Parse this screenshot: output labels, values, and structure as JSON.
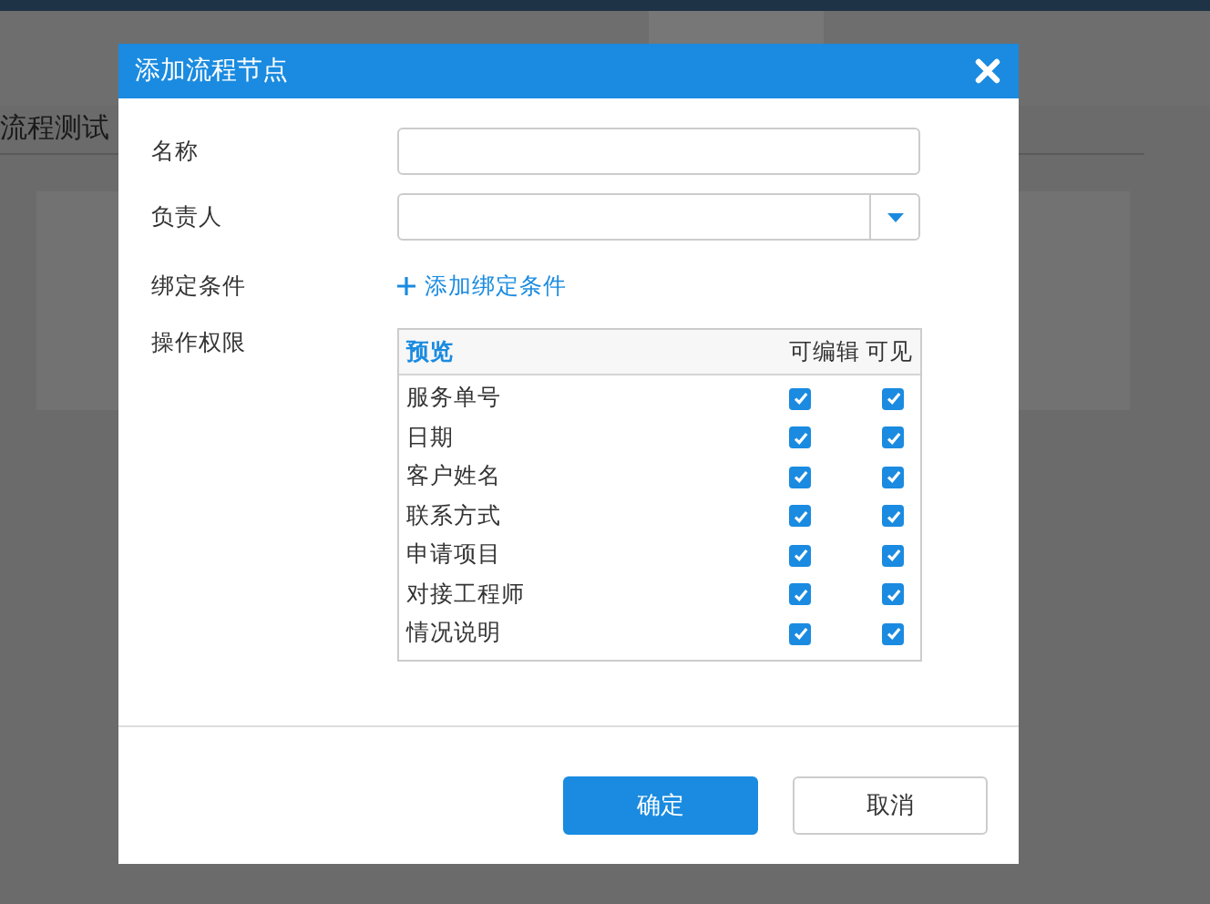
{
  "background": {
    "page_title": "流程测试"
  },
  "dialog": {
    "title": "添加流程节点",
    "fields": [
      {
        "kind": "text",
        "label": "名称"
      },
      {
        "kind": "select",
        "label": "负责人"
      },
      {
        "kind": "link",
        "label": "绑定条件",
        "link": "添加绑定条件"
      },
      {
        "kind": "table",
        "label": "操作权限"
      }
    ],
    "permissions": {
      "columns": [
        "预览",
        "可编辑",
        "可见"
      ],
      "rows": [
        {
          "name": "服务单号",
          "editable": true,
          "visible": true
        },
        {
          "name": "日期",
          "editable": true,
          "visible": true
        },
        {
          "name": "客户姓名",
          "editable": true,
          "visible": true
        },
        {
          "name": "联系方式",
          "editable": true,
          "visible": true
        },
        {
          "name": "申请项目",
          "editable": true,
          "visible": true
        },
        {
          "name": "对接工程师",
          "editable": true,
          "visible": true
        },
        {
          "name": "情况说明",
          "editable": true,
          "visible": true
        }
      ]
    },
    "buttons": [
      {
        "label": "确定",
        "primary": true
      },
      {
        "label": "取消",
        "primary": false
      }
    ]
  }
}
